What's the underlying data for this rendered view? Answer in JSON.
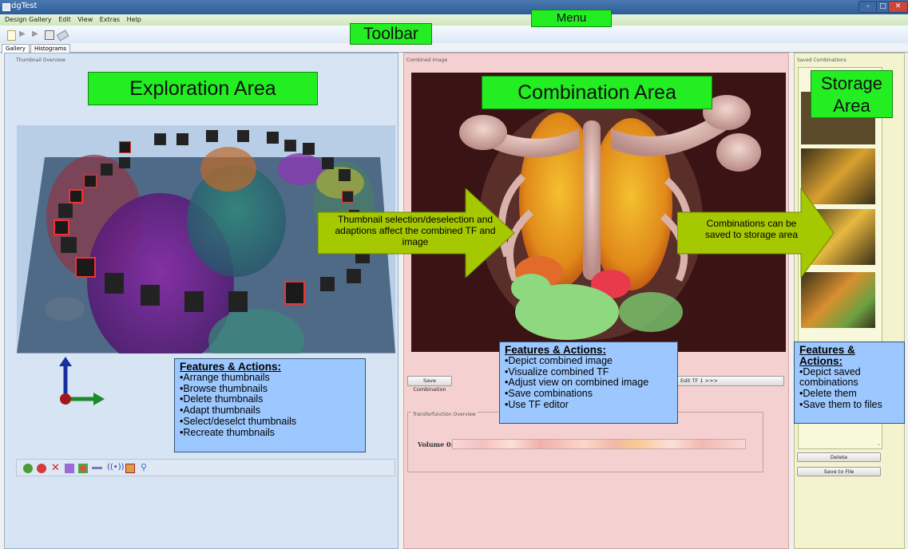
{
  "window": {
    "title": "dgTest",
    "minimize": "–",
    "maximize": "□",
    "close": "✕"
  },
  "menu": {
    "items": [
      "Design Gallery",
      "Edit",
      "View",
      "Extras",
      "Help"
    ]
  },
  "toolbar": {
    "icons": [
      "new-icon",
      "play-icon",
      "play-next-icon",
      "save-icon",
      "clear-icon"
    ]
  },
  "tabs": [
    "Gallery",
    "Histograms"
  ],
  "annotations": {
    "menu": "Menu",
    "toolbar": "Toolbar",
    "exploration": "Exploration Area",
    "combination": "Combination Area",
    "storage": "Storage Area"
  },
  "exploration": {
    "panel_label": "Thumbnail Overview",
    "features_title": "Features & Actions:",
    "features": [
      "•Arrange thumbnails",
      "•Browse thumbnails",
      "•Delete thumbnails",
      "•Adapt thumbnails",
      "•Select/deselct thumbnails",
      "•Recreate thumbnails"
    ],
    "tools": [
      "refresh-icon",
      "cancel-icon",
      "delete-icon",
      "paint-icon",
      "grid-icon",
      "connect-icon",
      "signal-icon",
      "edit-icon",
      "zoom-icon"
    ]
  },
  "arrow_1": "Thumbnail selection/deselection and adaptions affect the combined TF and image",
  "arrow_2": "Combinations can be saved to storage area",
  "combination": {
    "panel_label": "Combined Image",
    "save_button": "Save Combination",
    "edit_button": "Edit TF 1 >>>",
    "tf_label": "Transferfunction Overview",
    "volume_label": "Volume 0:",
    "features_title": "Features & Actions:",
    "features": [
      "•Depict combined image",
      "•Visualize combined TF",
      "•Adjust view on combined image",
      "•Save combinations",
      "•Use TF editor"
    ]
  },
  "storage": {
    "panel_label": "Saved Combinations",
    "delete_button": "Delete",
    "save_file_button": "Save to File",
    "features_title": "Features & Actions:",
    "features": [
      "•Depict saved combinations",
      "•Delete them",
      "•Save them to files"
    ]
  },
  "colors": {
    "label_green": "#22ee22",
    "arrow_green": "#a6c800",
    "feature_blue": "#9dc8ff"
  }
}
